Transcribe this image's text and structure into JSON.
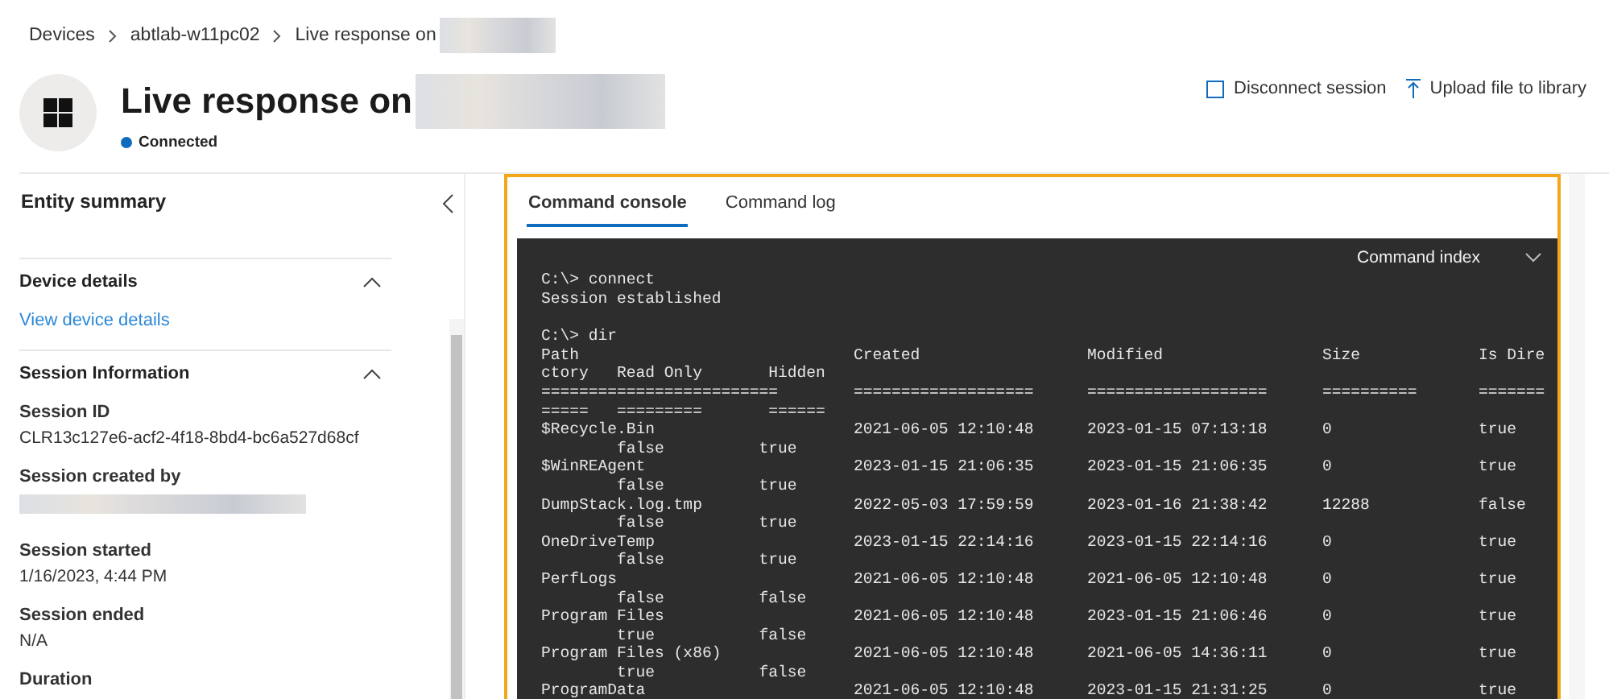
{
  "breadcrumb": [
    {
      "label": "Devices"
    },
    {
      "label": "abtlab-w11pc02"
    },
    {
      "label": "Live response on",
      "redacted_suffix": true
    }
  ],
  "header": {
    "title": "Live response on",
    "redacted_suffix": true,
    "status": {
      "label": "Connected",
      "color": "#0f6cbd"
    }
  },
  "actions": [
    {
      "kind": "disconnect",
      "label": "Disconnect session"
    },
    {
      "kind": "upload",
      "label": "Upload file to library"
    }
  ],
  "sidebar": {
    "title": "Entity summary",
    "sections": [
      {
        "title": "Device details",
        "expanded": true,
        "link": "View device details"
      },
      {
        "title": "Session Information",
        "expanded": true,
        "fields": [
          {
            "label": "Session ID",
            "value": "CLR13c127e6-acf2-4f18-8bd4-bc6a527d68cf"
          },
          {
            "label": "Session created by",
            "redacted": true
          },
          {
            "label": "Session started",
            "value": "1/16/2023, 4:44 PM"
          },
          {
            "label": "Session ended",
            "value": "N/A"
          },
          {
            "label": "Duration"
          }
        ]
      }
    ]
  },
  "tabs": [
    {
      "label": "Command console",
      "selected": true
    },
    {
      "label": "Command log",
      "selected": false
    }
  ],
  "console": {
    "command_index": "Command index",
    "lines": [
      {
        "kind": "text",
        "text": "C:\\> connect"
      },
      {
        "kind": "text",
        "text": "Session established"
      },
      {
        "kind": "blank"
      },
      {
        "kind": "text",
        "text": "C:\\> dir"
      },
      {
        "kind": "row",
        "cells": [
          "Path",
          "Created",
          "Modified",
          "Size",
          "Is Dire"
        ]
      },
      {
        "kind": "text",
        "text": "ctory   Read Only       Hidden"
      },
      {
        "kind": "row",
        "cells": [
          "=========================",
          "===================",
          "===================",
          "==========",
          "======="
        ]
      },
      {
        "kind": "text",
        "text": "=====   =========       ======"
      },
      {
        "kind": "row",
        "cells": [
          "$Recycle.Bin",
          "2021-06-05 12:10:48",
          "2023-01-15 07:13:18",
          "0",
          "true"
        ]
      },
      {
        "kind": "text",
        "text": "        false          true"
      },
      {
        "kind": "row",
        "cells": [
          "$WinREAgent",
          "2023-01-15 21:06:35",
          "2023-01-15 21:06:35",
          "0",
          "true"
        ]
      },
      {
        "kind": "text",
        "text": "        false          true"
      },
      {
        "kind": "row",
        "cells": [
          "DumpStack.log.tmp",
          "2022-05-03 17:59:59",
          "2023-01-16 21:38:42",
          "12288",
          "false"
        ]
      },
      {
        "kind": "text",
        "text": "        false          true"
      },
      {
        "kind": "row",
        "cells": [
          "OneDriveTemp",
          "2023-01-15 22:14:16",
          "2023-01-15 22:14:16",
          "0",
          "true"
        ]
      },
      {
        "kind": "text",
        "text": "        false          true"
      },
      {
        "kind": "row",
        "cells": [
          "PerfLogs",
          "2021-06-05 12:10:48",
          "2021-06-05 12:10:48",
          "0",
          "true"
        ]
      },
      {
        "kind": "text",
        "text": "        false          false"
      },
      {
        "kind": "row",
        "cells": [
          "Program Files",
          "2021-06-05 12:10:48",
          "2023-01-15 21:06:46",
          "0",
          "true"
        ]
      },
      {
        "kind": "text",
        "text": "        true           false"
      },
      {
        "kind": "row",
        "cells": [
          "Program Files (x86)",
          "2021-06-05 12:10:48",
          "2021-06-05 14:36:11",
          "0",
          "true"
        ]
      },
      {
        "kind": "text",
        "text": "        true           false"
      },
      {
        "kind": "row",
        "cells": [
          "ProgramData",
          "2021-06-05 12:10:48",
          "2023-01-15 21:31:25",
          "0",
          "true"
        ]
      }
    ]
  }
}
